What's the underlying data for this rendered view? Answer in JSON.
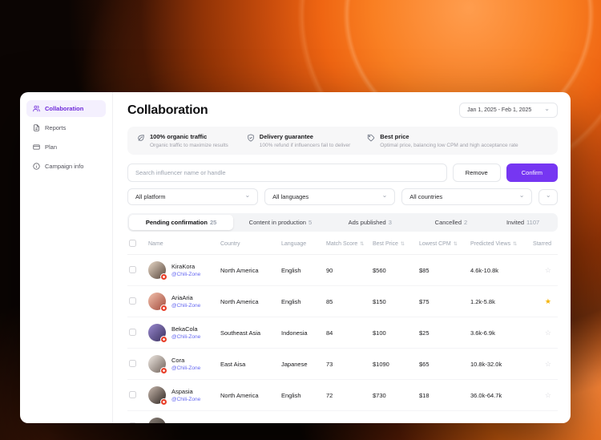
{
  "colors": {
    "accent": "#7636f2",
    "handle": "#6366f1",
    "star_filled": "#f5b40a",
    "star_empty": "#d6d6dc",
    "badge": "#e8412c"
  },
  "icons": {
    "chevron_down": "⌄",
    "sort": "⇅"
  },
  "sidebar": {
    "items": [
      {
        "label": "Collaboration"
      },
      {
        "label": "Reports"
      },
      {
        "label": "Plan"
      },
      {
        "label": "Campaign info"
      }
    ]
  },
  "header": {
    "title": "Collaboration",
    "date_range": "Jan 1, 2025 - Feb 1, 2025"
  },
  "benefits": [
    {
      "title": "100% organic traffic",
      "subtitle": "Organic traffic to maximize results"
    },
    {
      "title": "Delivery guarantee",
      "subtitle": "100% refund if influencers fail to deliver"
    },
    {
      "title": "Best price",
      "subtitle": "Optimal price, balancing low CPM and high acceptance rate"
    }
  ],
  "toolbar": {
    "search_placeholder": "Search influencer name or handle",
    "remove_label": "Remove",
    "confirm_label": "Confirm"
  },
  "filters": [
    {
      "label": "All platform"
    },
    {
      "label": "All languages"
    },
    {
      "label": "All countries"
    }
  ],
  "tabs": [
    {
      "label": "Pending confirmation",
      "count": "25",
      "active": true
    },
    {
      "label": "Content in production",
      "count": "5",
      "active": false
    },
    {
      "label": "Ads published",
      "count": "3",
      "active": false
    },
    {
      "label": "Cancelled",
      "count": "2",
      "active": false
    },
    {
      "label": "Invited",
      "count": "1107",
      "active": false
    }
  ],
  "table": {
    "columns": {
      "name": "Name",
      "country": "Country",
      "language": "Language",
      "match_score": "Match Score",
      "best_price": "Best Price",
      "lowest_cpm": "Lowest CPM",
      "predicted_views": "Predicted Views",
      "starred": "Starred"
    },
    "rows": [
      {
        "name": "KiraKora",
        "handle": "@Chili-Zone",
        "country": "North America",
        "language": "English",
        "match_score": "90",
        "best_price": "$560",
        "lowest_cpm": "$85",
        "predicted_views": "4.6k-10.8k",
        "starred": false,
        "star_icon": "☆",
        "star_color": "#d6d6dc",
        "avatar_bg": "linear-gradient(135deg,#e9d9c8,#57463c)"
      },
      {
        "name": "AriaAria",
        "handle": "@Chili-Zone",
        "country": "North America",
        "language": "English",
        "match_score": "85",
        "best_price": "$150",
        "lowest_cpm": "$75",
        "predicted_views": "1.2k-5.8k",
        "starred": true,
        "star_icon": "★",
        "star_color": "#f5b40a",
        "avatar_bg": "linear-gradient(135deg,#f3c3ae,#a34a3c)"
      },
      {
        "name": "BekaCola",
        "handle": "@Chili-Zone",
        "country": "Southeast Asia",
        "language": "Indonesia",
        "match_score": "84",
        "best_price": "$100",
        "lowest_cpm": "$25",
        "predicted_views": "3.6k-6.9k",
        "starred": false,
        "star_icon": "☆",
        "star_color": "#d6d6dc",
        "avatar_bg": "linear-gradient(135deg,#9b8ad0,#39305e)"
      },
      {
        "name": "Cora",
        "handle": "@Chili-Zone",
        "country": "East Aisa",
        "language": "Japanese",
        "match_score": "73",
        "best_price": "$1090",
        "lowest_cpm": "$65",
        "predicted_views": "10.8k-32.0k",
        "starred": false,
        "star_icon": "☆",
        "star_color": "#d6d6dc",
        "avatar_bg": "linear-gradient(135deg,#f0eae4,#6e6058)"
      },
      {
        "name": "Aspasia",
        "handle": "@Chili-Zone",
        "country": "North America",
        "language": "English",
        "match_score": "72",
        "best_price": "$730",
        "lowest_cpm": "$18",
        "predicted_views": "36.0k-64.7k",
        "starred": false,
        "star_icon": "☆",
        "star_color": "#d6d6dc",
        "avatar_bg": "linear-gradient(135deg,#c9b9ae,#2e2622)"
      },
      {
        "name": "",
        "handle": "",
        "country": "",
        "language": "",
        "match_score": "",
        "best_price": "",
        "lowest_cpm": "",
        "predicted_views": "",
        "starred": false,
        "star_icon": "☆",
        "star_color": "#d6d6dc",
        "avatar_bg": "linear-gradient(135deg,#8a8078,#3a332e)"
      }
    ]
  }
}
